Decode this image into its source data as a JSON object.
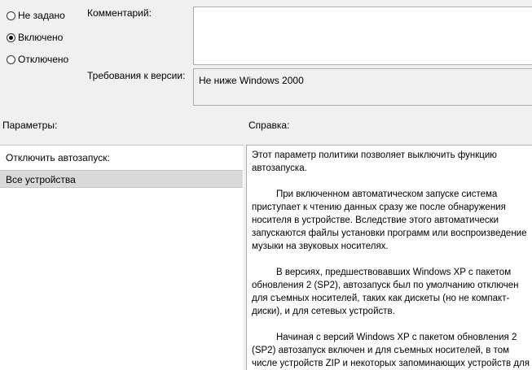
{
  "state": {
    "options": [
      {
        "label": "Не задано",
        "checked": false
      },
      {
        "label": "Включено",
        "checked": true
      },
      {
        "label": "Отключено",
        "checked": false
      }
    ]
  },
  "comment": {
    "label": "Комментарий:",
    "value": ""
  },
  "supported_on": {
    "label": "Требования к версии:",
    "value": "Не ниже Windows 2000"
  },
  "options_pane": {
    "title": "Параметры:",
    "heading": "Отключить автозапуск:",
    "dropdown_value": "Все устройства"
  },
  "help_pane": {
    "title": "Справка:",
    "paragraphs": [
      "Этот параметр политики позволяет выключить функцию автозапуска.",
      "При включенном автоматическом запуске система приступает к чтению данных сразу же после обнаружения носителя в устройстве. Вследствие этого автоматически запускаются файлы установки программ или воспроизведение музыки на звуковых носителях.",
      "В версиях, предшествовавших Windows XP с пакетом обновления 2 (SP2), автозапуск был по умолчанию отключен для съемных носителей, таких как дискеты (но не компакт-диски), и для сетевых устройств.",
      "Начиная с версий Windows XP с пакетом обновления 2 (SP2) автозапуск включен и для съемных носителей, в том числе устройств ZIP и некоторых запоминающих устройств для"
    ]
  }
}
